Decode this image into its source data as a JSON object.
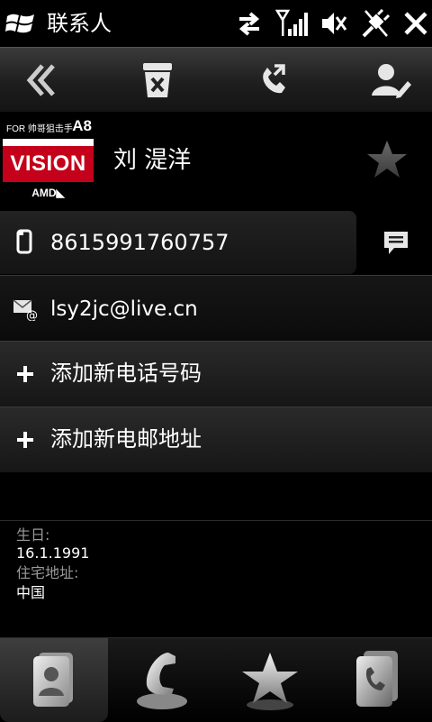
{
  "app": {
    "title": "联系人"
  },
  "status_icons": [
    "sync-arrows-icon",
    "signal-icon",
    "volume-muted-icon",
    "power-plug-icon",
    "close-icon"
  ],
  "toolbar": {
    "buttons": [
      "back-icon",
      "delete-icon",
      "call-forward-icon",
      "edit-contact-icon"
    ]
  },
  "contact": {
    "name": "刘 湜洋",
    "avatar": {
      "top_text": "FOR 帅哥狙击手",
      "top_big": "A8",
      "brand": "VISION",
      "sub": "AMD◣"
    },
    "favorite_icon": "star-icon"
  },
  "rows": {
    "phone": {
      "icon": "mobile-phone-icon",
      "value": "8615991760757",
      "action_icon": "sms-icon"
    },
    "email": {
      "icon": "email-icon",
      "value": "lsy2jc@live.cn"
    },
    "add_phone": {
      "icon": "plus-icon",
      "label": "添加新电话号码"
    },
    "add_email": {
      "icon": "plus-icon",
      "label": "添加新电邮地址"
    }
  },
  "details": {
    "birthday_label": "生日:",
    "birthday_value": "16.1.1991",
    "home_address_label": "住宅地址:",
    "home_address_value": "中国"
  },
  "tabs": [
    {
      "name": "contact-card-tab",
      "active": true
    },
    {
      "name": "call-history-tab",
      "active": false
    },
    {
      "name": "favorites-tab",
      "active": false
    },
    {
      "name": "contact-phone-tab",
      "active": false
    }
  ],
  "colors": {
    "background": "#000000",
    "accent_red": "#c4001a",
    "label_gray": "#9a9a9a"
  }
}
